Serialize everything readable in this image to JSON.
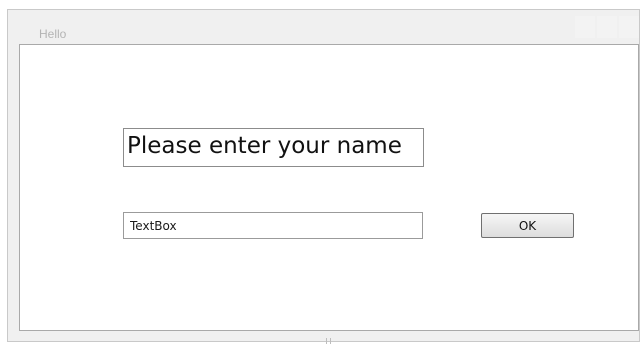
{
  "window": {
    "title": "Hello"
  },
  "form": {
    "prompt": "Please enter your name",
    "name_input_value": "TextBox",
    "ok_label": "OK"
  },
  "colors": {
    "window_frame": "#f0f0f0",
    "client_background": "#ffffff",
    "title_text": "#b4b4b4"
  }
}
